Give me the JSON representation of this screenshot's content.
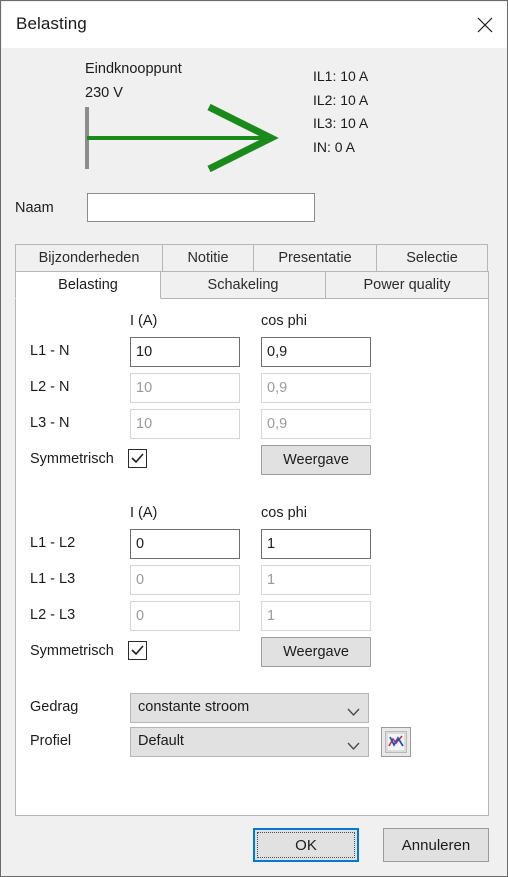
{
  "window": {
    "title": "Belasting",
    "close_icon": "close-icon"
  },
  "diagram": {
    "node_label": "Eindknooppunt",
    "voltage": "230 V",
    "arrow_color": "#1a8a1a",
    "bar_color": "#8c8c8c",
    "readout": [
      "IL1: 10 A",
      "IL2: 10 A",
      "IL3: 10 A",
      "IN: 0 A"
    ]
  },
  "name_field": {
    "label": "Naam",
    "value": "",
    "placeholder": ""
  },
  "tabs": {
    "row1": [
      {
        "label": "Bijzonderheden",
        "active": false
      },
      {
        "label": "Notitie",
        "active": false
      },
      {
        "label": "Presentatie",
        "active": false
      },
      {
        "label": "Selectie",
        "active": false
      }
    ],
    "row2": [
      {
        "label": "Belasting",
        "active": true
      },
      {
        "label": "Schakeling",
        "active": false
      },
      {
        "label": "Power quality",
        "active": false
      }
    ]
  },
  "group_phase_neutral": {
    "header_current": "I (A)",
    "header_cosphi": "cos phi",
    "rows": [
      {
        "label": "L1 - N",
        "current": "10",
        "cosphi": "0,9",
        "enabled": true
      },
      {
        "label": "L2 - N",
        "current": "10",
        "cosphi": "0,9",
        "enabled": false
      },
      {
        "label": "L3 - N",
        "current": "10",
        "cosphi": "0,9",
        "enabled": false
      }
    ],
    "symmetric_label": "Symmetrisch",
    "symmetric_checked": true,
    "display_button": "Weergave"
  },
  "group_phase_phase": {
    "header_current": "I (A)",
    "header_cosphi": "cos phi",
    "rows": [
      {
        "label": "L1 - L2",
        "current": "0",
        "cosphi": "1",
        "enabled": true
      },
      {
        "label": "L1 - L3",
        "current": "0",
        "cosphi": "1",
        "enabled": false
      },
      {
        "label": "L2 - L3",
        "current": "0",
        "cosphi": "1",
        "enabled": false
      }
    ],
    "symmetric_label": "Symmetrisch",
    "symmetric_checked": true,
    "display_button": "Weergave"
  },
  "selectors": {
    "behavior_label": "Gedrag",
    "behavior_value": "constante stroom",
    "profile_label": "Profiel",
    "profile_value": "Default",
    "profile_chart_icon": "chart-icon"
  },
  "footer": {
    "ok_label": "OK",
    "cancel_label": "Annuleren",
    "accent_color": "#0078d7"
  }
}
